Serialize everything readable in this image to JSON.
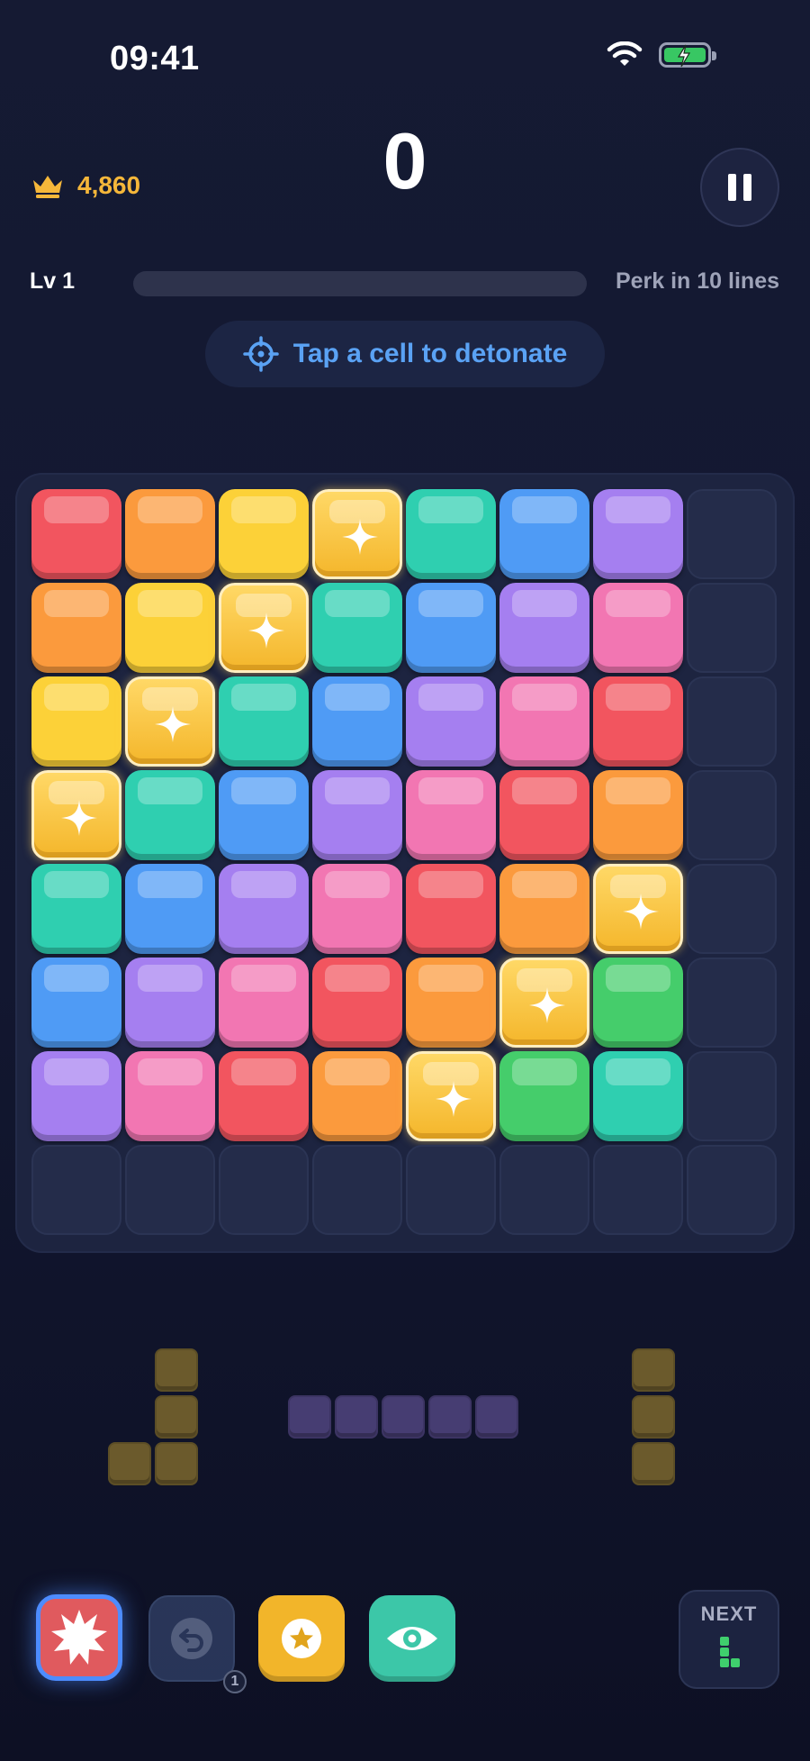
{
  "status": {
    "time": "09:41"
  },
  "header": {
    "best_score": "4,860",
    "score": "0"
  },
  "level": {
    "label": "Lv 1",
    "progress": 0.0,
    "perk_text": "Perk in 10 lines"
  },
  "hint": {
    "text": "Tap a cell to detonate"
  },
  "colors": {
    "R": "#f2555f",
    "O": "#fb9a3d",
    "Y": "#fcd138",
    "S": "#f8c43d",
    "T": "#2fcfb0",
    "B": "#4f9bf5",
    "P": "#a57ff0",
    "K": "#f276b2",
    "G": "#45cd6b"
  },
  "board": {
    "size": 8,
    "rows": [
      "ROYSTBP.",
      "OYSTBPK.",
      "YSTBPKR.",
      "STBPKRO.",
      "TBPKROS.",
      "BPKROSG.",
      "PKROSGT.",
      "........"
    ]
  },
  "pieces": [
    {
      "color": "olive",
      "cells": [
        [
          1,
          0
        ],
        [
          1,
          1
        ],
        [
          0,
          2
        ],
        [
          1,
          2
        ]
      ]
    },
    {
      "color": "purple",
      "cells": [
        [
          0,
          0
        ],
        [
          1,
          0
        ],
        [
          2,
          0
        ],
        [
          3,
          0
        ],
        [
          4,
          0
        ]
      ]
    },
    {
      "color": "olive",
      "cells": [
        [
          0,
          0
        ],
        [
          0,
          1
        ],
        [
          0,
          2
        ]
      ]
    }
  ],
  "toolbar": {
    "undo_count": "1"
  },
  "next": {
    "label": "NEXT"
  }
}
